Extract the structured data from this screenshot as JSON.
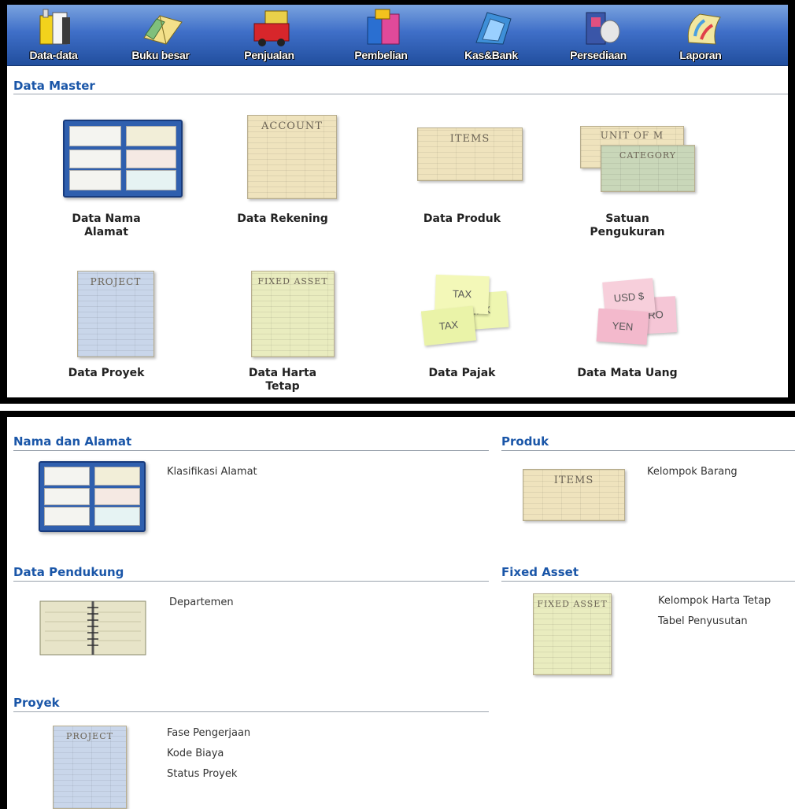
{
  "toolbar": {
    "items": [
      {
        "label": "Data-data",
        "icon": "folders-icon"
      },
      {
        "label": "Buku besar",
        "icon": "ledger-book-icon"
      },
      {
        "label": "Penjualan",
        "icon": "delivery-truck-icon"
      },
      {
        "label": "Pembelian",
        "icon": "shopping-bag-icon"
      },
      {
        "label": "Kas&Bank",
        "icon": "bank-icon"
      },
      {
        "label": "Persediaan",
        "icon": "warehouse-icon"
      },
      {
        "label": "Laporan",
        "icon": "report-scroll-icon"
      }
    ]
  },
  "data_master": {
    "title": "Data Master",
    "tiles": [
      {
        "label_1": "Data Nama",
        "label_2": "Alamat",
        "icon": "address-book-icon"
      },
      {
        "label_1": "Data Rekening",
        "label_2": "",
        "icon": "account-sheet-icon",
        "caption": "ACCOUNT"
      },
      {
        "label_1": "Data Produk",
        "label_2": "",
        "icon": "items-sheet-icon",
        "caption": "ITEMS"
      },
      {
        "label_1": "Satuan",
        "label_2": "Pengukuran",
        "icon": "unit-category-sheet-icon",
        "caption": "UNIT OF M",
        "caption_2": "CATEGORY"
      },
      {
        "label_1": "Data Proyek",
        "label_2": "",
        "icon": "project-sheet-icon",
        "caption": "PROJECT"
      },
      {
        "label_1": "Data Harta",
        "label_2": "Tetap",
        "icon": "fixed-asset-sheet-icon",
        "caption": "FIXED ASSET"
      },
      {
        "label_1": "Data Pajak",
        "label_2": "",
        "icon": "tax-notes-icon",
        "note_1": "TAX",
        "note_2": "TAX",
        "note_3": "TAX"
      },
      {
        "label_1": "Data Mata Uang",
        "label_2": "",
        "icon": "currency-notes-icon",
        "note_1": "USD $",
        "note_2": "EURO",
        "note_3": "YEN"
      }
    ]
  },
  "sections": {
    "nama_alamat": {
      "title": "Nama dan Alamat",
      "links": [
        "Klasifikasi Alamat"
      ]
    },
    "produk": {
      "title": "Produk",
      "links": [
        "Kelompok Barang"
      ],
      "caption": "ITEMS"
    },
    "pendukung": {
      "title": "Data Pendukung",
      "links": [
        "Departemen"
      ]
    },
    "fixed_asset": {
      "title": "Fixed Asset",
      "links": [
        "Kelompok Harta Tetap",
        "Tabel Penyusutan"
      ],
      "caption": "FIXED ASSET"
    },
    "proyek": {
      "title": "Proyek",
      "links": [
        "Fase Pengerjaan",
        "Kode Biaya",
        "Status Proyek"
      ],
      "caption": "PROJECT"
    }
  },
  "colors": {
    "toolbar": "#3f6fc8",
    "section_title": "#1a56a8",
    "frame": "#000000"
  }
}
